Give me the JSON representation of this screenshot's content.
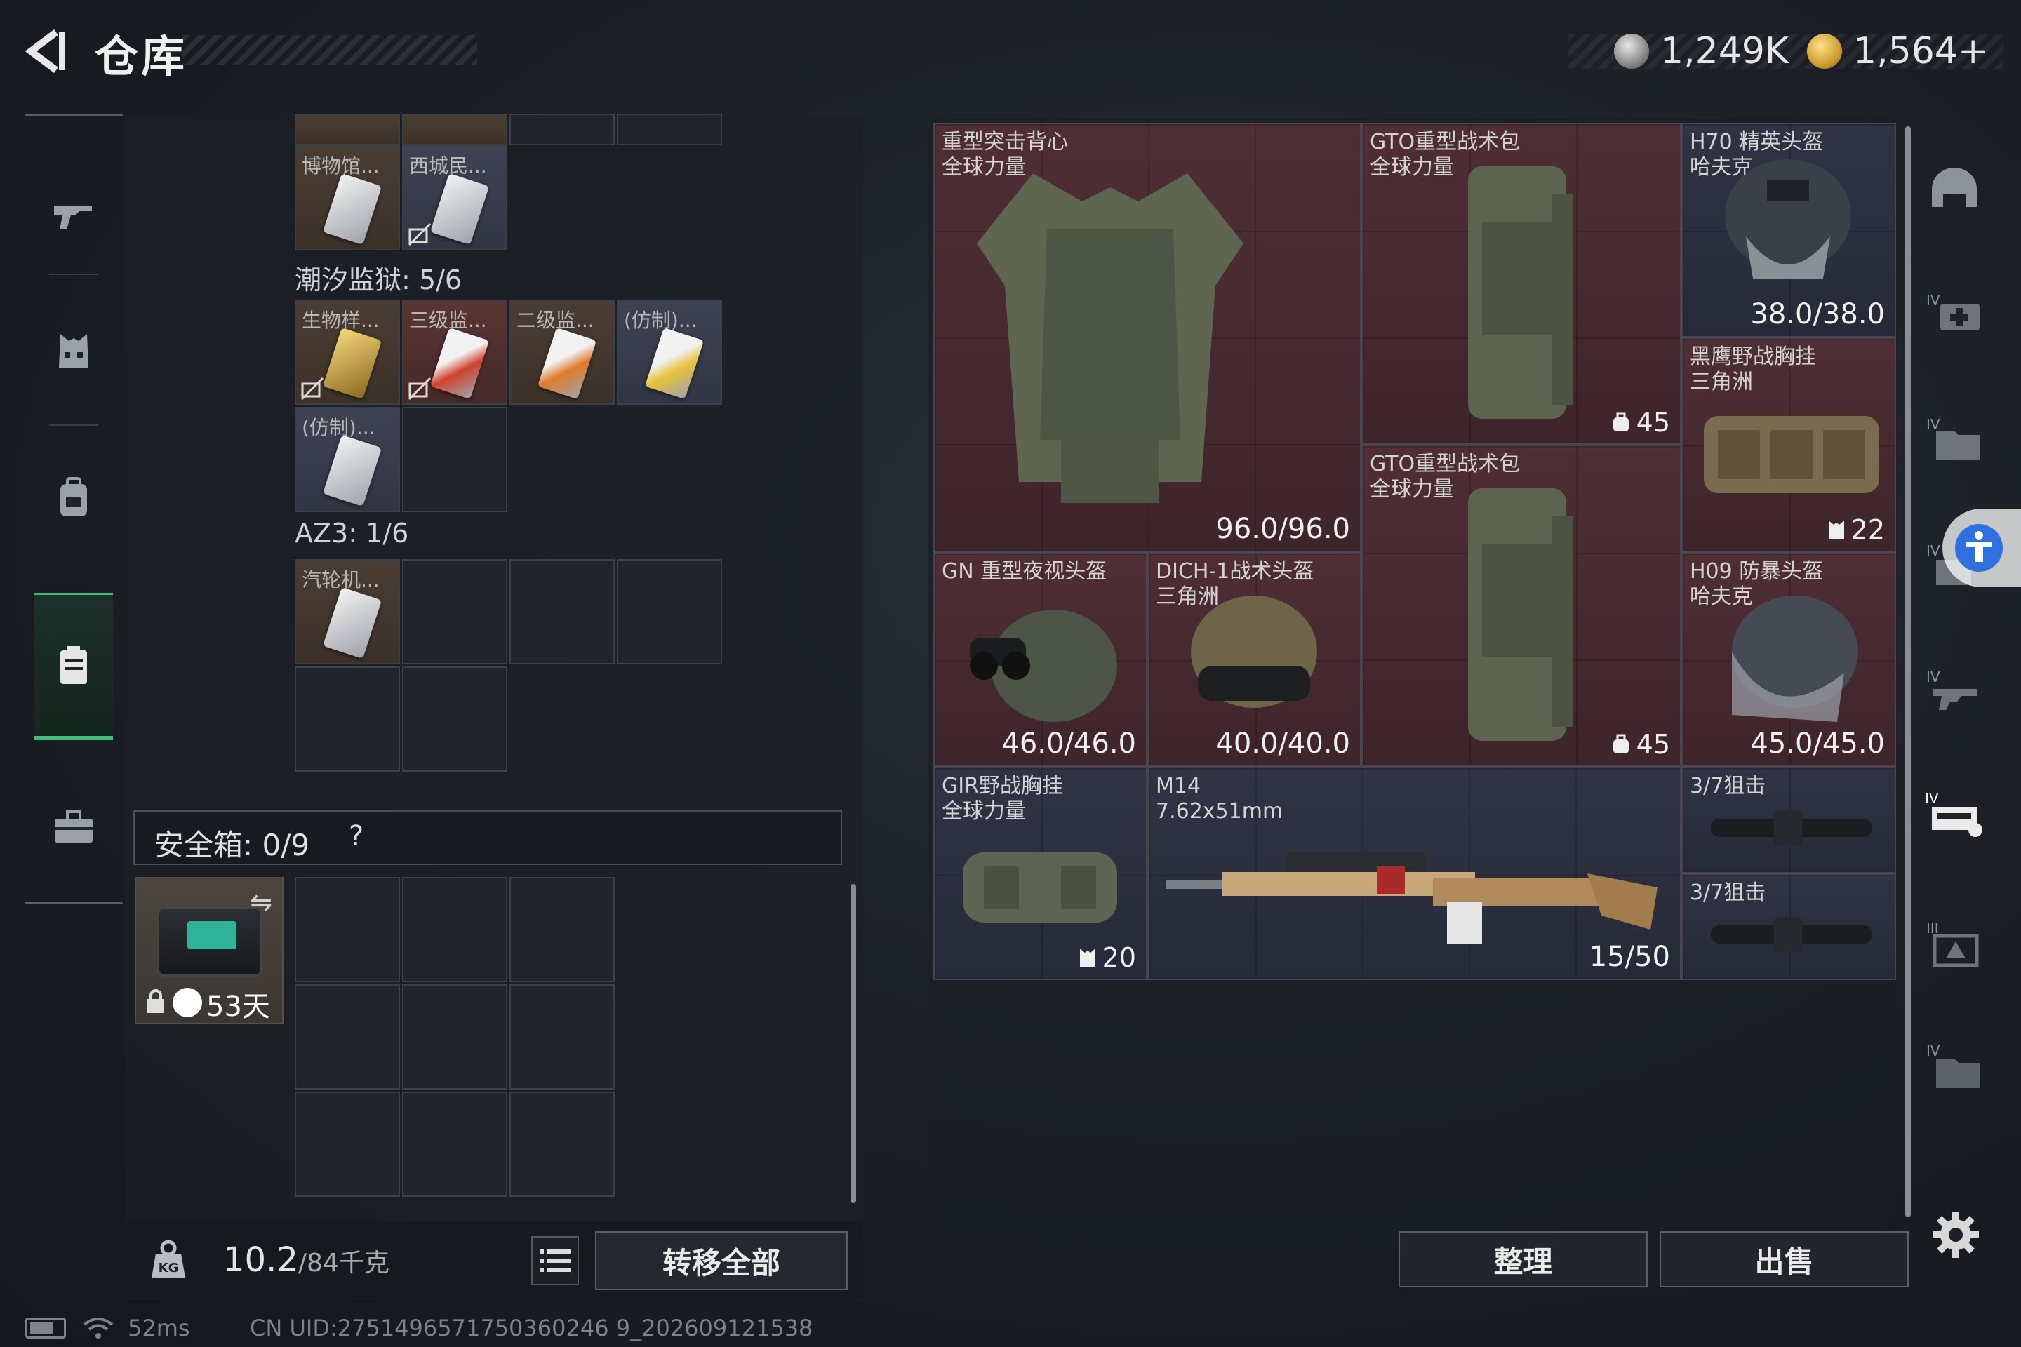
{
  "header": {
    "title": "仓库",
    "currency_1": "1,249K",
    "currency_2": "1,564+"
  },
  "left_nav": [
    {
      "id": "weapons",
      "icon": "gun-icon"
    },
    {
      "id": "armor",
      "icon": "vest-icon"
    },
    {
      "id": "backpack",
      "icon": "backpack-icon"
    },
    {
      "id": "stash",
      "icon": "container-icon",
      "active": true
    },
    {
      "id": "case",
      "icon": "briefcase-icon"
    }
  ],
  "stash": {
    "top_row_labels": [
      "博物馆...",
      "西城民..."
    ],
    "section_1": "潮汐监狱: 5/6",
    "row2_labels": [
      "生物样...",
      "三级监...",
      "二级监...",
      "(仿制)..."
    ],
    "row3_labels": [
      "(仿制)..."
    ],
    "section_2": "AZ3: 1/6",
    "row4_labels": [
      "汽轮机..."
    ],
    "safe_box_label": "安全箱: 0/9",
    "safe_box_help": "?",
    "safe_case_days": "53天"
  },
  "footer_left": {
    "weight_value": "10.2",
    "weight_max": "/84千克",
    "transfer_all": "转移全部"
  },
  "equipment": [
    {
      "id": "heavy-vest",
      "name": "重型突击背心\n全球力量",
      "value": "96.0/96.0",
      "color": "r"
    },
    {
      "id": "gto-backpack-1",
      "name": "GTO重型战术包\n全球力量",
      "value": "45",
      "color": "r",
      "kind": "cap"
    },
    {
      "id": "h70-helmet",
      "name": "H70 精英头盔\n哈夫克",
      "value": "38.0/38.0",
      "color": "b"
    },
    {
      "id": "black-eagle-rig",
      "name": "黑鹰野战胸挂\n三角洲",
      "value": "22",
      "color": "r",
      "kind": "cap"
    },
    {
      "id": "gto-backpack-2",
      "name": "GTO重型战术包\n全球力量",
      "value": "45",
      "color": "r",
      "kind": "cap"
    },
    {
      "id": "gn-helmet",
      "name": "GN 重型夜视头盔",
      "value": "46.0/46.0",
      "color": "r"
    },
    {
      "id": "dich-helmet",
      "name": "DICH-1战术头盔\n三角洲",
      "value": "40.0/40.0",
      "color": "r"
    },
    {
      "id": "h09-helmet",
      "name": "H09 防暴头盔\n哈夫克",
      "value": "45.0/45.0",
      "color": "r"
    },
    {
      "id": "gir-rig",
      "name": "GIR野战胸挂\n全球力量",
      "value": "20",
      "color": "b",
      "kind": "cap"
    },
    {
      "id": "m14-rifle",
      "name": "M14\n7.62x51mm",
      "value": "15/50",
      "color": "b"
    },
    {
      "id": "scope-1",
      "name": "3/7狙击",
      "value": "",
      "color": "b"
    },
    {
      "id": "scope-2",
      "name": "3/7狙击",
      "value": "",
      "color": "b"
    }
  ],
  "footer_right": {
    "sort": "整理",
    "sell": "出售"
  },
  "status": {
    "ping": "52ms",
    "uid": "CN UID:2751496571750360246 9_202609121538"
  },
  "colors": {
    "accent_green": "#3fbf7f",
    "item_red": "#4f2e35",
    "item_blue": "#2f3344",
    "item_brown": "#4a3d33"
  }
}
